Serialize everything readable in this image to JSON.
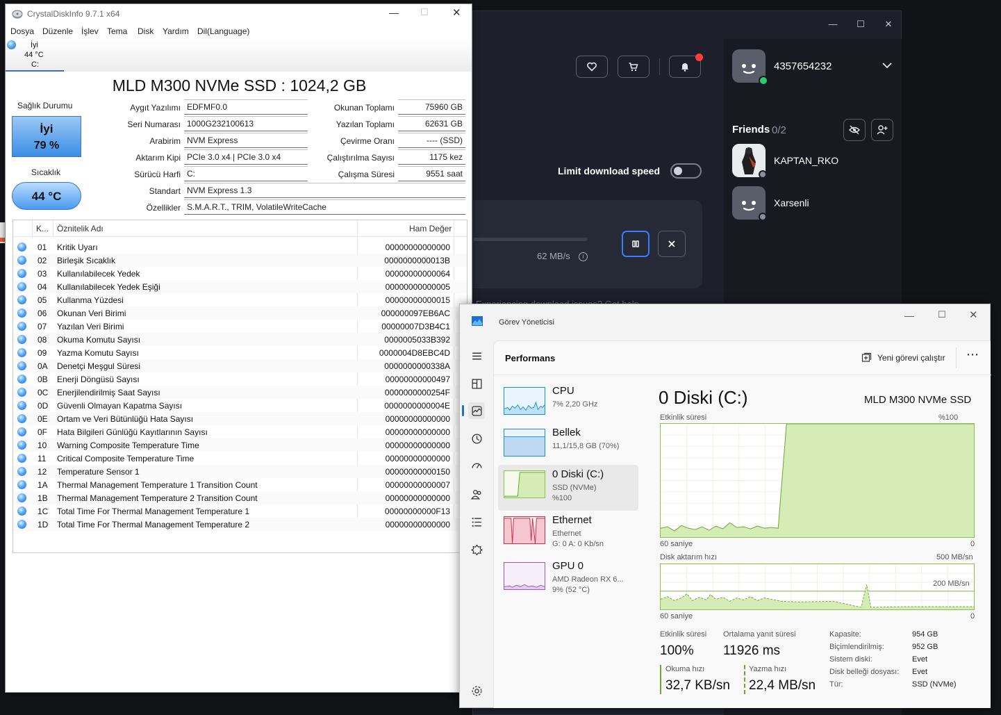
{
  "launcher": {
    "user_id": "4357654232",
    "friends_label": "Friends",
    "friends_count": "0/2",
    "friends": [
      {
        "name": "KAPTAN_RKO"
      },
      {
        "name": "Xarsenli"
      }
    ],
    "limit_download_label": "Limit download speed",
    "download_speed": "62 MB/s",
    "footer_text": "Experiencing download issues? Get help"
  },
  "cdi": {
    "title": "CrystalDiskInfo 9.7.1 x64",
    "menu": [
      "Dosya",
      "Düzenle",
      "İşlev",
      "Tema",
      "Disk",
      "Yardım",
      "Dil(Language)"
    ],
    "drive_tab": {
      "status": "İyi",
      "temp": "44 °C",
      "letter": "C:"
    },
    "model": "MLD M300 NVMe SSD : 1024,2 GB",
    "health_label": "Sağlık Durumu",
    "health_status": "İyi",
    "health_pct": "79 %",
    "temp_label": "Sıcaklık",
    "temp_value": "44 °C",
    "left_fields": [
      {
        "label": "Aygıt Yazılımı",
        "value": "EDFMF0.0"
      },
      {
        "label": "Seri Numarası",
        "value": "1000G232100613"
      },
      {
        "label": "Arabirim",
        "value": "NVM Express"
      },
      {
        "label": "Aktarım Kipi",
        "value": "PCIe 3.0 x4 | PCIe 3.0 x4"
      },
      {
        "label": "Sürücü Harfi",
        "value": "C:"
      }
    ],
    "right_fields": [
      {
        "label": "Okunan Toplamı",
        "value": "75960 GB"
      },
      {
        "label": "Yazılan Toplamı",
        "value": "62631 GB"
      },
      {
        "label": "Çevirme Oranı",
        "value": "---- (SSD)"
      },
      {
        "label": "Çalıştırılma Sayısı",
        "value": "1175 kez"
      },
      {
        "label": "Çalışma Süresi",
        "value": "9551 saat"
      }
    ],
    "standard_label": "Standart",
    "standard_value": "NVM Express 1.3",
    "features_label": "Özellikler",
    "features_value": "S.M.A.R.T., TRIM, VolatileWriteCache",
    "table_headers": {
      "id": "K...",
      "name": "Öznitelik Adı",
      "raw": "Ham Değer"
    },
    "attributes": [
      {
        "id": "01",
        "name": "Kritik Uyarı",
        "raw": "00000000000000"
      },
      {
        "id": "02",
        "name": "Birleşik Sıcaklık",
        "raw": "0000000000013B"
      },
      {
        "id": "03",
        "name": "Kullanılabilecek Yedek",
        "raw": "00000000000064"
      },
      {
        "id": "04",
        "name": "Kullanılabilecek Yedek Eşiği",
        "raw": "00000000000005"
      },
      {
        "id": "05",
        "name": "Kullanma Yüzdesi",
        "raw": "00000000000015"
      },
      {
        "id": "06",
        "name": "Okunan Veri Birimi",
        "raw": "000000097EB6AC"
      },
      {
        "id": "07",
        "name": "Yazılan Veri Birimi",
        "raw": "00000007D3B4C1"
      },
      {
        "id": "08",
        "name": "Okuma Komutu Sayısı",
        "raw": "0000005033B392"
      },
      {
        "id": "09",
        "name": "Yazma Komutu Sayısı",
        "raw": "0000004D8EBC4D"
      },
      {
        "id": "0A",
        "name": "Denetçi Meşgul Süresi",
        "raw": "0000000000338A"
      },
      {
        "id": "0B",
        "name": "Enerji Döngüsü Sayısı",
        "raw": "00000000000497"
      },
      {
        "id": "0C",
        "name": "Enerjilendirilmiş Saat Sayısı",
        "raw": "0000000000254F"
      },
      {
        "id": "0D",
        "name": "Güvenli Olmayan Kapatma Sayısı",
        "raw": "0000000000004E"
      },
      {
        "id": "0E",
        "name": "Ortam ve Veri Bütünlüğü Hata Sayısı",
        "raw": "00000000000000"
      },
      {
        "id": "0F",
        "name": "Hata Bilgileri Günlüğü Kayıtlarının Sayısı",
        "raw": "00000000000000"
      },
      {
        "id": "10",
        "name": "Warning Composite Temperature Time",
        "raw": "00000000000000"
      },
      {
        "id": "11",
        "name": "Critical Composite Temperature Time",
        "raw": "00000000000000"
      },
      {
        "id": "12",
        "name": "Temperature Sensor 1",
        "raw": "00000000000150"
      },
      {
        "id": "1A",
        "name": "Thermal Management Temperature 1 Transition Count",
        "raw": "00000000000007"
      },
      {
        "id": "1B",
        "name": "Thermal Management Temperature 2 Transition Count",
        "raw": "00000000000000"
      },
      {
        "id": "1C",
        "name": "Total Time For Thermal Management Temperature 1",
        "raw": "00000000000F13"
      },
      {
        "id": "1D",
        "name": "Total Time For Thermal Management Temperature 2",
        "raw": "00000000000000"
      }
    ]
  },
  "tm": {
    "title": "Görev Yöneticisi",
    "page_title": "Performans",
    "run_task_label": "Yeni görevi çalıştır",
    "sidebar": [
      {
        "name": "CPU",
        "line1": "7% 2,20 GHz",
        "line2": ""
      },
      {
        "name": "Bellek",
        "line1": "11,1/15,8 GB (70%)",
        "line2": ""
      },
      {
        "name": "0 Diski (C:)",
        "line1": "SSD (NVMe)",
        "line2": "%100"
      },
      {
        "name": "Ethernet",
        "line1": "Ethernet",
        "line2": "G: 0 A: 0 Kb/sn"
      },
      {
        "name": "GPU 0",
        "line1": "AMD Radeon RX 6...",
        "line2": "9% (52 °C)"
      }
    ],
    "disk_title": "0 Diski (C:)",
    "disk_model": "MLD M300 NVMe SSD",
    "chart1_label": "Etkinlik süresi",
    "chart1_max": "%100",
    "chart1_xlabel": "60 saniye",
    "chart1_min": "0",
    "chart2_label": "Disk aktarım hızı",
    "chart2_max": "500 MB/sn",
    "chart2_mid": "200 MB/sn",
    "chart2_xlabel": "60 saniye",
    "chart2_min": "0",
    "active_time_label": "Etkinlik süresi",
    "active_time": "100%",
    "avg_response_label": "Ortalama yanıt süresi",
    "avg_response": "11926 ms",
    "read_label": "Okuma hızı",
    "read_speed": "32,7 KB/sn",
    "write_label": "Yazma hızı",
    "write_speed": "22,4 MB/sn",
    "props": [
      {
        "k": "Kapasite:",
        "v": "954 GB"
      },
      {
        "k": "Biçimlendirilmiş:",
        "v": "952 GB"
      },
      {
        "k": "Sistem diski:",
        "v": "Evet"
      },
      {
        "k": "Disk belleği dosyası:",
        "v": "Evet"
      },
      {
        "k": "Tür:",
        "v": "SSD (NVMe)"
      }
    ]
  },
  "colors": {
    "disk_green": "#8bc34a",
    "disk_fill": "#d5ecb7",
    "cpu_blue": "#1a8fdb",
    "mem_purple": "#7a3cb5",
    "eth_pink": "#c4314b",
    "gpu_purple": "#9b59b6",
    "cdi_blue": "#3b8ede",
    "launcher_bg": "#1d202a"
  }
}
